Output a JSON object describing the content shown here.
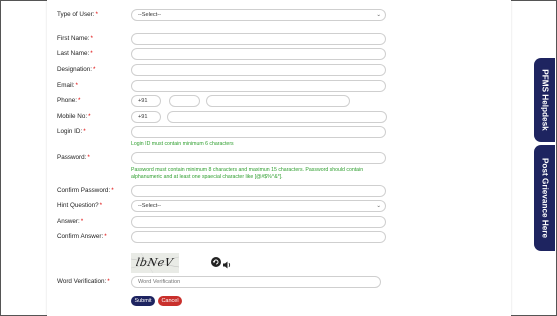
{
  "form": {
    "type_of_user": {
      "label": "Type of User:",
      "value": "--Select--"
    },
    "first_name": {
      "label": "First Name:"
    },
    "last_name": {
      "label": "Last Name:"
    },
    "designation": {
      "label": "Designation:"
    },
    "email": {
      "label": "Email:"
    },
    "phone": {
      "label": "Phone:",
      "code": "+91"
    },
    "mobile": {
      "label": "Mobile No:",
      "code": "+91"
    },
    "login_id": {
      "label": "Login ID:",
      "hint": "Login ID must contain minimum 6 characters"
    },
    "password": {
      "label": "Password:",
      "hint": "Password must contain minimum 8 characters and maximun 15 characters. Password should contain alphanumeric and at least one spaecial character like [@#$%^&*]."
    },
    "confirm_password": {
      "label": "Confirm Password:"
    },
    "hint_question": {
      "label": "Hint Question?",
      "value": "--Select--"
    },
    "answer": {
      "label": "Answer:"
    },
    "confirm_answer": {
      "label": "Confirm Answer:"
    },
    "captcha": {
      "text": "lbNeV"
    },
    "word_verification": {
      "label": "Word Verification:",
      "placeholder": "Word Verification"
    },
    "required_mark": "*",
    "submit_label": "Submit",
    "cancel_label": "Cancel"
  },
  "side_tabs": {
    "helpdesk": "PFMS Helpdesk",
    "grievance": "Post Grievance Here"
  },
  "colors": {
    "navy": "#1e2460",
    "cancel_red": "#c9302c",
    "hint_green": "#2e9e2e",
    "required_red": "#dd0000"
  },
  "icons": {
    "audio": "speaker-icon",
    "refresh": "refresh-icon"
  }
}
